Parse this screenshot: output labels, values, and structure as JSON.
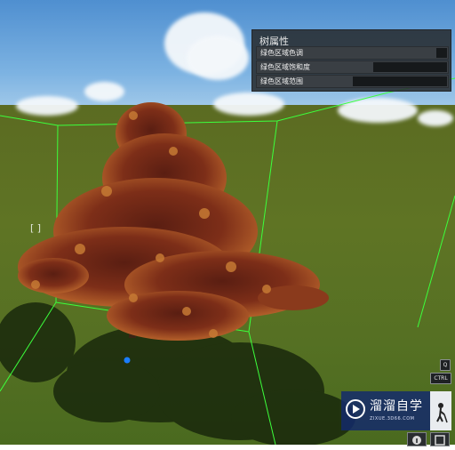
{
  "panel": {
    "title": "树属性",
    "properties": [
      {
        "label": "绿色区域色调",
        "value": 0.1
      },
      {
        "label": "绿色区域饱和度",
        "value": 0.7
      },
      {
        "label": "绿色区域范围",
        "value": 0.9
      }
    ]
  },
  "overlay": {
    "key_q": "Q",
    "key_ctrl": "CTRL"
  },
  "watermark": {
    "name": "溜溜自学",
    "url": "ZIXUE.3D66.COM"
  },
  "icons": {
    "cursor": "bracket-cursor-icon",
    "logo": "play-logo-icon",
    "figure": "person-digging-icon",
    "bottom": [
      "info-icon",
      "square-icon"
    ]
  },
  "colors": {
    "panel_bg": "#2c3034",
    "selection_box": "#3cff3c",
    "slider_fill": "#16191b",
    "foliage": "#8a3a1c"
  }
}
